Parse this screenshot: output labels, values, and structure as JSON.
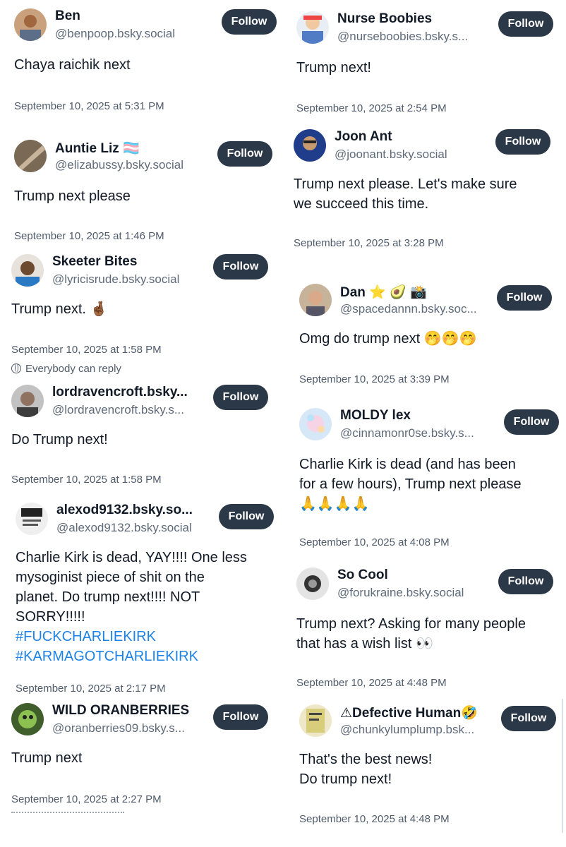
{
  "follow_label": "Follow",
  "reply_setting": "Everybody can reply",
  "posts": [
    {
      "name": "Ben",
      "handle": "@benpoop.bsky.social",
      "text": "Chaya raichik next",
      "time": "September 10, 2025 at 5:31 PM"
    },
    {
      "name": "Auntie Liz 🏳️‍⚧️",
      "handle": "@elizabussy.bsky.social",
      "text": "Trump next please",
      "time": "September 10, 2025 at 1:46 PM"
    },
    {
      "name": "Skeeter Bites",
      "handle": "@lyricisrude.bsky.social",
      "text": "Trump next. 🤞🏾",
      "time": "September 10, 2025 at 1:58 PM"
    },
    {
      "name": "lordravencroft.bsky...",
      "handle": "@lordravencroft.bsky.s...",
      "text": "Do Trump next!",
      "time": "September 10, 2025 at 1:58 PM"
    },
    {
      "name": "alexod9132.bsky.so...",
      "handle": "@alexod9132.bsky.social",
      "text_lines": [
        "Charlie Kirk is dead, YAY!!!! One less",
        "mysoginist piece of shit on the",
        "planet. Do trump next!!!! NOT",
        "SORRY!!!!!"
      ],
      "hashtags": [
        "#FUCKCHARLIEKIRK",
        "#KARMAGOTCHARLIEKIRK"
      ],
      "time": "September 10, 2025 at 2:17 PM"
    },
    {
      "name": "WILD ORANBERRIES",
      "handle": "@oranberries09.bsky.s...",
      "text": "Trump next",
      "time": "September 10, 2025 at 2:27 PM"
    },
    {
      "name": "Nurse Boobies",
      "handle": "@nurseboobies.bsky.s...",
      "text": "Trump next!",
      "time": "September 10, 2025 at 2:54 PM"
    },
    {
      "name": "Joon Ant",
      "handle": "@joonant.bsky.social",
      "text_lines": [
        "Trump next please. Let's make sure",
        "we succeed this time."
      ],
      "time": "September 10, 2025 at 3:28 PM"
    },
    {
      "name": "Dan ⭐ 🥑 📸",
      "handle": "@spacedannn.bsky.soc...",
      "text": "Omg do trump next 🤭🤭🤭",
      "time": "September 10, 2025 at 3:39 PM"
    },
    {
      "name": "MOLDY lex",
      "handle": "@cinnamonr0se.bsky.s...",
      "text_lines": [
        "Charlie Kirk is dead (and has been",
        "for a few hours), Trump next please",
        "🙏🙏🙏🙏"
      ],
      "time": "September 10, 2025 at 4:08 PM"
    },
    {
      "name": "So Cool",
      "handle": "@forukraine.bsky.social",
      "text_lines": [
        "Trump next? Asking for many people",
        "that has a wish list 👀"
      ],
      "time": "September 10, 2025 at 4:48 PM"
    },
    {
      "name": "⚠Defective Human🤣",
      "handle": "@chunkylumplump.bsk...",
      "text_lines": [
        "That's the best news!",
        "Do trump next!"
      ],
      "time": "September 10, 2025 at 4:48 PM"
    }
  ]
}
